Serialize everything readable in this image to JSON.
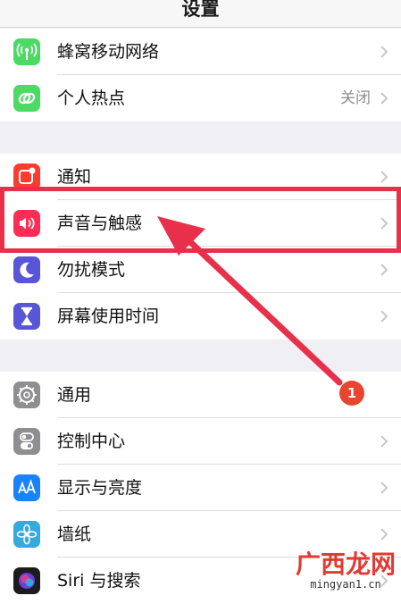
{
  "header": {
    "title": "设置"
  },
  "groups": [
    {
      "items": [
        {
          "label": "蜂窝移动网络",
          "value": "",
          "icon": "antenna-icon",
          "color": "#4cd964"
        },
        {
          "label": "个人热点",
          "value": "关闭",
          "icon": "link-icon",
          "color": "#4cd964"
        }
      ]
    },
    {
      "items": [
        {
          "label": "通知",
          "value": "",
          "icon": "notification-icon",
          "color": "#ff3b30"
        },
        {
          "label": "声音与触感",
          "value": "",
          "icon": "speaker-icon",
          "color": "#ff2d55"
        },
        {
          "label": "勿扰模式",
          "value": "",
          "icon": "moon-icon",
          "color": "#5856d6"
        },
        {
          "label": "屏幕使用时间",
          "value": "",
          "icon": "hourglass-icon",
          "color": "#5856d6"
        }
      ]
    },
    {
      "items": [
        {
          "label": "通用",
          "value": "",
          "icon": "gear-icon",
          "color": "#8e8e93"
        },
        {
          "label": "控制中心",
          "value": "",
          "icon": "toggles-icon",
          "color": "#8e8e93"
        },
        {
          "label": "显示与亮度",
          "value": "",
          "icon": "text-size-icon",
          "color": "#1a82fb"
        },
        {
          "label": "墙纸",
          "value": "",
          "icon": "flower-icon",
          "color": "#35aadc"
        },
        {
          "label": "Siri 与搜索",
          "value": "",
          "icon": "siri-icon",
          "color": "#1c1c1e"
        }
      ]
    }
  ],
  "annotation": {
    "badge": "1",
    "highlight_color": "#e8304a"
  },
  "watermark": {
    "top": "广西龙网",
    "bottom": "mingyan1.cn"
  }
}
